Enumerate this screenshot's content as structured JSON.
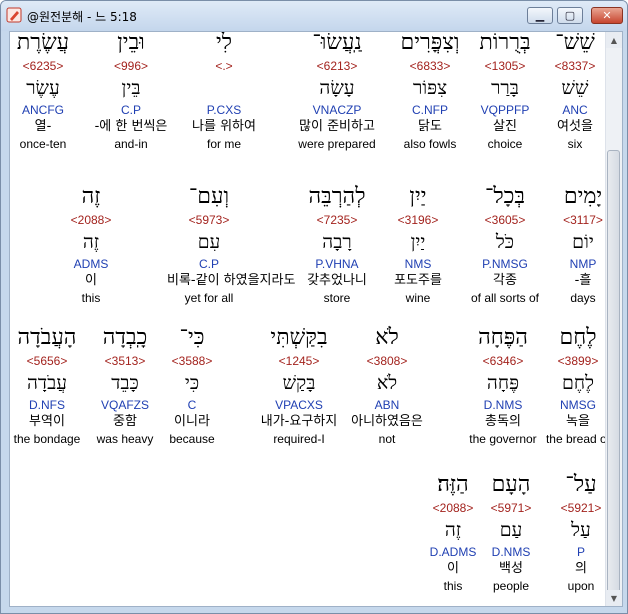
{
  "window": {
    "title": "@원전분해 - 느 5:18"
  },
  "rows": [
    [
      {
        "heb": "שֵׁשׁ־",
        "num": "<8337>",
        "lemma": "שֵׁשׁ",
        "morph": "ANC",
        "kor": "여섯을",
        "eng": "six"
      },
      {
        "heb": "בְּרֻרוֹת",
        "num": "<1305>",
        "lemma": "בָּרַר",
        "morph": "VQPPFP",
        "kor": "살진",
        "eng": "choice"
      },
      {
        "heb": "וְצִפֳּרִים",
        "num": "<6833>",
        "lemma": "צִפּוֹר",
        "morph": "C.NFP",
        "kor": "닭도",
        "eng": "also fowls"
      },
      {
        "heb": "נַֽעֲשׂוּ־",
        "num": "<6213>",
        "lemma": "עָשָׂה",
        "morph": "VNACZP",
        "kor": "많이 준비하고",
        "eng": "were prepared"
      },
      {
        "heb": "לִי",
        "num": "<.>",
        "lemma": "",
        "morph": "P.CXS",
        "kor": "나를 위하여",
        "eng": "for me"
      },
      {
        "heb": "וּבֵין",
        "num": "<996>",
        "lemma": "בֵּין",
        "morph": "C.P",
        "kor": "-에 한 번씩은",
        "eng": "and-in"
      },
      {
        "heb": "עֲשֶׂרֶת",
        "num": "<6235>",
        "lemma": "עֶשֶׂר",
        "morph": "ANCFG",
        "kor": "열-",
        "eng": "once-ten"
      }
    ],
    [
      {
        "heb": "יָמִים",
        "num": "<3117>",
        "lemma": "יוֹם",
        "morph": "NMP",
        "kor": "-흘",
        "eng": "days"
      },
      {
        "heb": "בְּכָל־",
        "num": "<3605>",
        "lemma": "כֹּל",
        "morph": "P.NMSG",
        "kor": "각종",
        "eng": "of all sorts of"
      },
      {
        "heb": "יַיִן",
        "num": "<3196>",
        "lemma": "יַיִן",
        "morph": "NMS",
        "kor": "포도주를",
        "eng": "wine"
      },
      {
        "heb": "לְהַרְבֵּה",
        "num": "<7235>",
        "lemma": "רָבָה",
        "morph": "P.VHNA",
        "kor": "갖추었나니",
        "eng": "store"
      },
      {
        "heb": "וְעִם־",
        "num": "<5973>",
        "lemma": "עִם",
        "morph": "C.P",
        "kor": "비록-같이 하였을지라도",
        "eng": "yet for all"
      },
      {
        "heb": "זֶה",
        "num": "<2088>",
        "lemma": "זֶה",
        "morph": "ADMS",
        "kor": "이",
        "eng": "this"
      }
    ],
    [
      {
        "heb": "לֶחֶם",
        "num": "<3899>",
        "lemma": "לֶחֶם",
        "morph": "NMSG",
        "kor": "녹을",
        "eng": "the bread of"
      },
      {
        "heb": "הַפֶּחָה",
        "num": "<6346>",
        "lemma": "פֶּחָה",
        "morph": "D.NMS",
        "kor": "총독의",
        "eng": "the governor"
      },
      {
        "heb": "לֹא",
        "num": "<3808>",
        "lemma": "לֹא",
        "morph": "ABN",
        "kor": "아니하였음은",
        "eng": "not"
      },
      {
        "heb": "בִקַּשְׁתִּי",
        "num": "<1245>",
        "lemma": "בָּקַשׁ",
        "morph": "VPACXS",
        "kor": "내가-요구하지",
        "eng": "required-I"
      },
      {
        "heb": "כִּי־",
        "num": "<3588>",
        "lemma": "כִּי",
        "morph": "C",
        "kor": "이니라",
        "eng": "because"
      },
      {
        "heb": "כָֽבְדָה",
        "num": "<3513>",
        "lemma": "כָּבֵד",
        "morph": "VQAFZS",
        "kor": "중함",
        "eng": "was heavy"
      },
      {
        "heb": "הָעֲבֹדָה",
        "num": "<5656>",
        "lemma": "עֲבֹדָה",
        "morph": "D.NFS",
        "kor": "부역이",
        "eng": "the bondage"
      }
    ],
    [
      {
        "heb": "עַל־",
        "num": "<5921>",
        "lemma": "עַל",
        "morph": "P",
        "kor": "의",
        "eng": "upon"
      },
      {
        "heb": "הָעָם",
        "num": "<5971>",
        "lemma": "עַם",
        "morph": "D.NMS",
        "kor": "백성",
        "eng": "people"
      },
      {
        "heb": "הַזֶּה׃",
        "num": "<2088>",
        "lemma": "זֶה",
        "morph": "D.ADMS",
        "kor": "이",
        "eng": "this"
      }
    ]
  ]
}
